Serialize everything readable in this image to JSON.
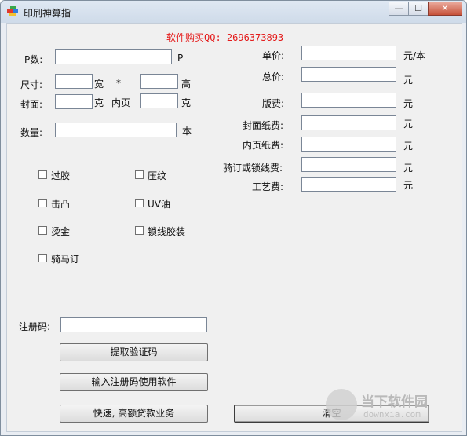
{
  "window": {
    "title": "印刷神算指",
    "min_glyph": "—",
    "max_glyph": "☐",
    "close_glyph": "✕"
  },
  "promo": "软件购买QQ: 2696373893",
  "left": {
    "p_label": "P数:",
    "p_unit": "P",
    "size_label": "尺寸:",
    "width_unit": "宽",
    "times": "*",
    "height_unit": "高",
    "cover_label": "封面:",
    "cover_unit": "克",
    "inner_label": "内页",
    "inner_unit": "克",
    "qty_label": "数量:",
    "qty_unit": "本"
  },
  "right": {
    "unit_price_label": "单价:",
    "unit_price_unit": "元/本",
    "total_label": "总价:",
    "total_unit": "元",
    "plate_label": "版费:",
    "plate_unit": "元",
    "cover_paper_label": "封面纸费:",
    "cover_paper_unit": "元",
    "inner_paper_label": "内页纸费:",
    "inner_paper_unit": "元",
    "binding_label": "骑订或锁线费:",
    "binding_unit": "元",
    "craft_label": "工艺费:",
    "craft_unit": "元"
  },
  "options": {
    "lamination": "过胶",
    "emboss": "压纹",
    "raised": "击凸",
    "uv": "UV油",
    "foil": "烫金",
    "sewn": "锁线胶装",
    "saddle": "骑马订"
  },
  "reg": {
    "label": "注册码:",
    "get_code": "提取验证码",
    "enter_code": "输入注册码使用软件",
    "loan": "快速, 高额贷款业务"
  },
  "clear": "清空",
  "watermark": {
    "name": "当下软件园",
    "url": "downxia.com"
  },
  "colors": {
    "promo": "#e41a1a"
  }
}
